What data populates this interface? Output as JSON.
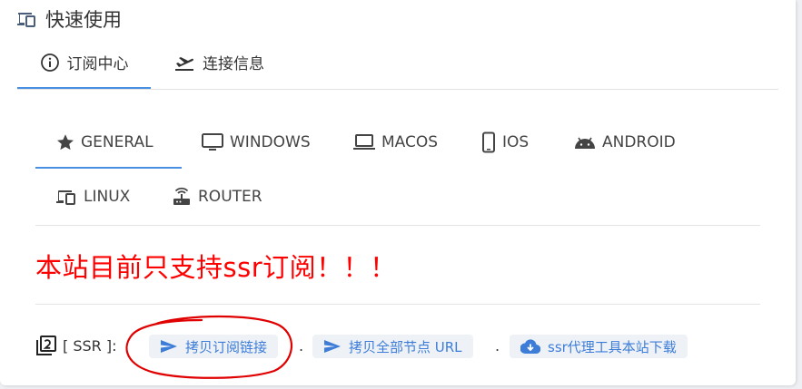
{
  "card": {
    "title": "快速使用",
    "title_icon": "devices-icon"
  },
  "top_tabs": [
    {
      "label": "订阅中心",
      "icon": "info-icon",
      "active": true
    },
    {
      "label": "连接信息",
      "icon": "flight-takeoff-icon",
      "active": false
    }
  ],
  "os_tabs": [
    {
      "label": "GENERAL",
      "icon": "star-icon",
      "active": true
    },
    {
      "label": "WINDOWS",
      "icon": "monitor-icon",
      "active": false
    },
    {
      "label": "MACOS",
      "icon": "laptop-icon",
      "active": false
    },
    {
      "label": "IOS",
      "icon": "phone-icon",
      "active": false
    },
    {
      "label": "ANDROID",
      "icon": "android-icon",
      "active": false
    },
    {
      "label": "LINUX",
      "icon": "devices-icon",
      "active": false
    },
    {
      "label": "ROUTER",
      "icon": "router-icon",
      "active": false
    }
  ],
  "notice": "本站目前只支持ssr订阅！！！",
  "ssr": {
    "label": "[ SSR ]:",
    "separator": ".",
    "buttons": [
      {
        "label": "拷贝订阅链接",
        "icon": "send-icon"
      },
      {
        "label": "拷贝全部节点 URL",
        "icon": "send-icon"
      },
      {
        "label": "ssr代理工具本站下载",
        "icon": "cloud-download-icon"
      }
    ]
  },
  "colors": {
    "accent": "#4a90e2",
    "button_text": "#3d7dd8",
    "button_bg": "#eef2f7",
    "notice": "#ff0000",
    "annotation": "#e00000"
  }
}
